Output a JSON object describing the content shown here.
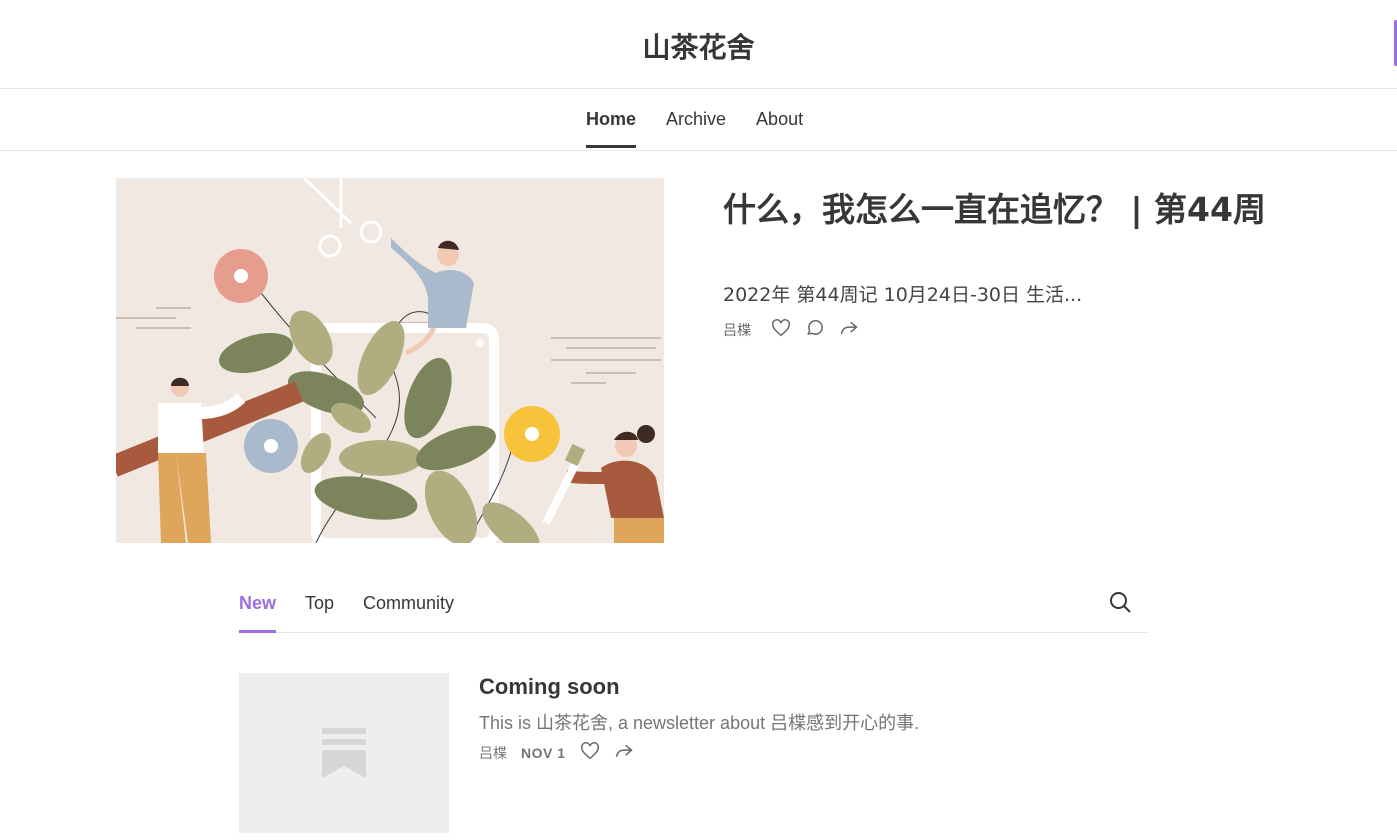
{
  "site": {
    "title": "山茶花舍"
  },
  "nav": {
    "items": [
      "Home",
      "Archive",
      "About"
    ],
    "active": "Home"
  },
  "featured": {
    "title": "什么，我怎么一直在追忆？ | 第44周",
    "subtitle": "2022年 第44周记 10月24日-30日 生活...",
    "author": "吕楪",
    "icons": [
      "heart-icon",
      "comment-icon",
      "share-icon"
    ]
  },
  "tabs": {
    "items": [
      "New",
      "Top",
      "Community"
    ],
    "active": "New"
  },
  "posts": [
    {
      "title": "Coming soon",
      "subtitle": "This is 山茶花舍, a newsletter about 吕楪感到开心的事.",
      "author": "吕楪",
      "date": "NOV 1",
      "icons": [
        "heart-icon",
        "share-icon"
      ]
    }
  ],
  "colors": {
    "accent": "#9a6ee0",
    "text": "#363737",
    "muted": "#757575"
  }
}
